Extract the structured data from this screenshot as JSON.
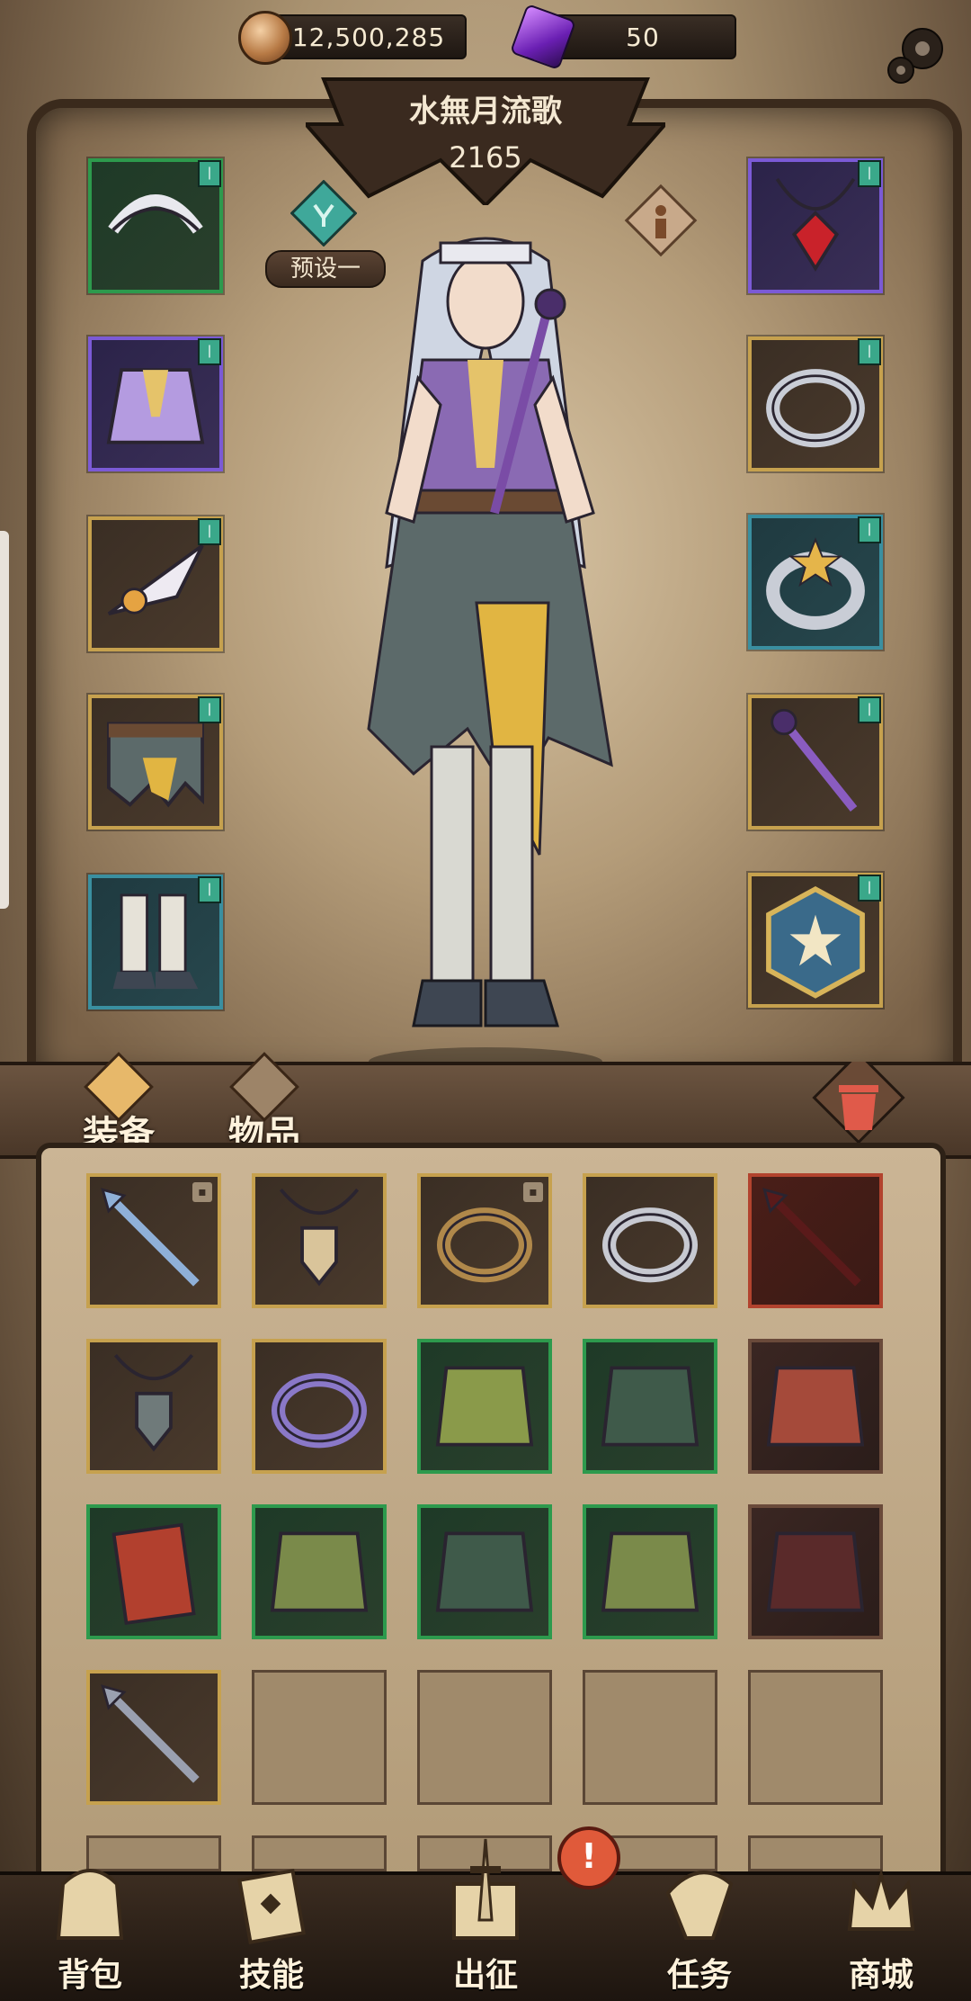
{
  "resources": {
    "gold": "12,500,285",
    "gems": "50"
  },
  "character": {
    "name": "水無月流歌",
    "power": "2165"
  },
  "preset": {
    "label": "预设一"
  },
  "tabs": [
    {
      "label": "装备"
    },
    {
      "label": "物品"
    }
  ],
  "nav": [
    {
      "label": "背包"
    },
    {
      "label": "技能"
    },
    {
      "label": "出征"
    },
    {
      "label": "任务"
    },
    {
      "label": "商城"
    }
  ],
  "alert_mark": "!",
  "equipment_left": [
    {
      "item": "maid-headband",
      "rarity": "green"
    },
    {
      "item": "purple-dress",
      "rarity": "purple"
    },
    {
      "item": "feather-gloves",
      "rarity": "gold"
    },
    {
      "item": "tattered-skirt",
      "rarity": "gold"
    },
    {
      "item": "white-boots",
      "rarity": "teal"
    }
  ],
  "equipment_right": [
    {
      "item": "ruby-necklace",
      "rarity": "purple"
    },
    {
      "item": "silver-ring",
      "rarity": "gold"
    },
    {
      "item": "star-ring",
      "rarity": "teal"
    },
    {
      "item": "eye-staff",
      "rarity": "gold"
    },
    {
      "item": "star-tome",
      "rarity": "gold"
    }
  ],
  "inventory": [
    {
      "item": "spear",
      "rarity": "gold",
      "locked": true
    },
    {
      "item": "cross-amulet",
      "rarity": "gold",
      "locked": false
    },
    {
      "item": "ruby-bronze-ring",
      "rarity": "gold",
      "locked": true
    },
    {
      "item": "pink-gem-ring",
      "rarity": "gold",
      "locked": false
    },
    {
      "item": "crimson-spear",
      "rarity": "red",
      "locked": false
    },
    {
      "item": "chain-helm-amulet",
      "rarity": "gold",
      "locked": false
    },
    {
      "item": "purple-ring",
      "rarity": "gold",
      "locked": false
    },
    {
      "item": "moss-gloves",
      "rarity": "green",
      "locked": false
    },
    {
      "item": "green-skirt",
      "rarity": "green",
      "locked": false
    },
    {
      "item": "red-armor",
      "rarity": "dark",
      "locked": false
    },
    {
      "item": "red-book",
      "rarity": "green",
      "locked": false
    },
    {
      "item": "moss-boots",
      "rarity": "green",
      "locked": false
    },
    {
      "item": "green-skirt-2",
      "rarity": "green",
      "locked": false
    },
    {
      "item": "moss-armor",
      "rarity": "green",
      "locked": false
    },
    {
      "item": "dark-boots",
      "rarity": "dark",
      "locked": false
    },
    {
      "item": "mace-staff",
      "rarity": "gold",
      "locked": false
    },
    {
      "item": "",
      "rarity": "empty",
      "locked": false
    },
    {
      "item": "",
      "rarity": "empty",
      "locked": false
    },
    {
      "item": "",
      "rarity": "empty",
      "locked": false
    },
    {
      "item": "",
      "rarity": "empty",
      "locked": false
    }
  ]
}
